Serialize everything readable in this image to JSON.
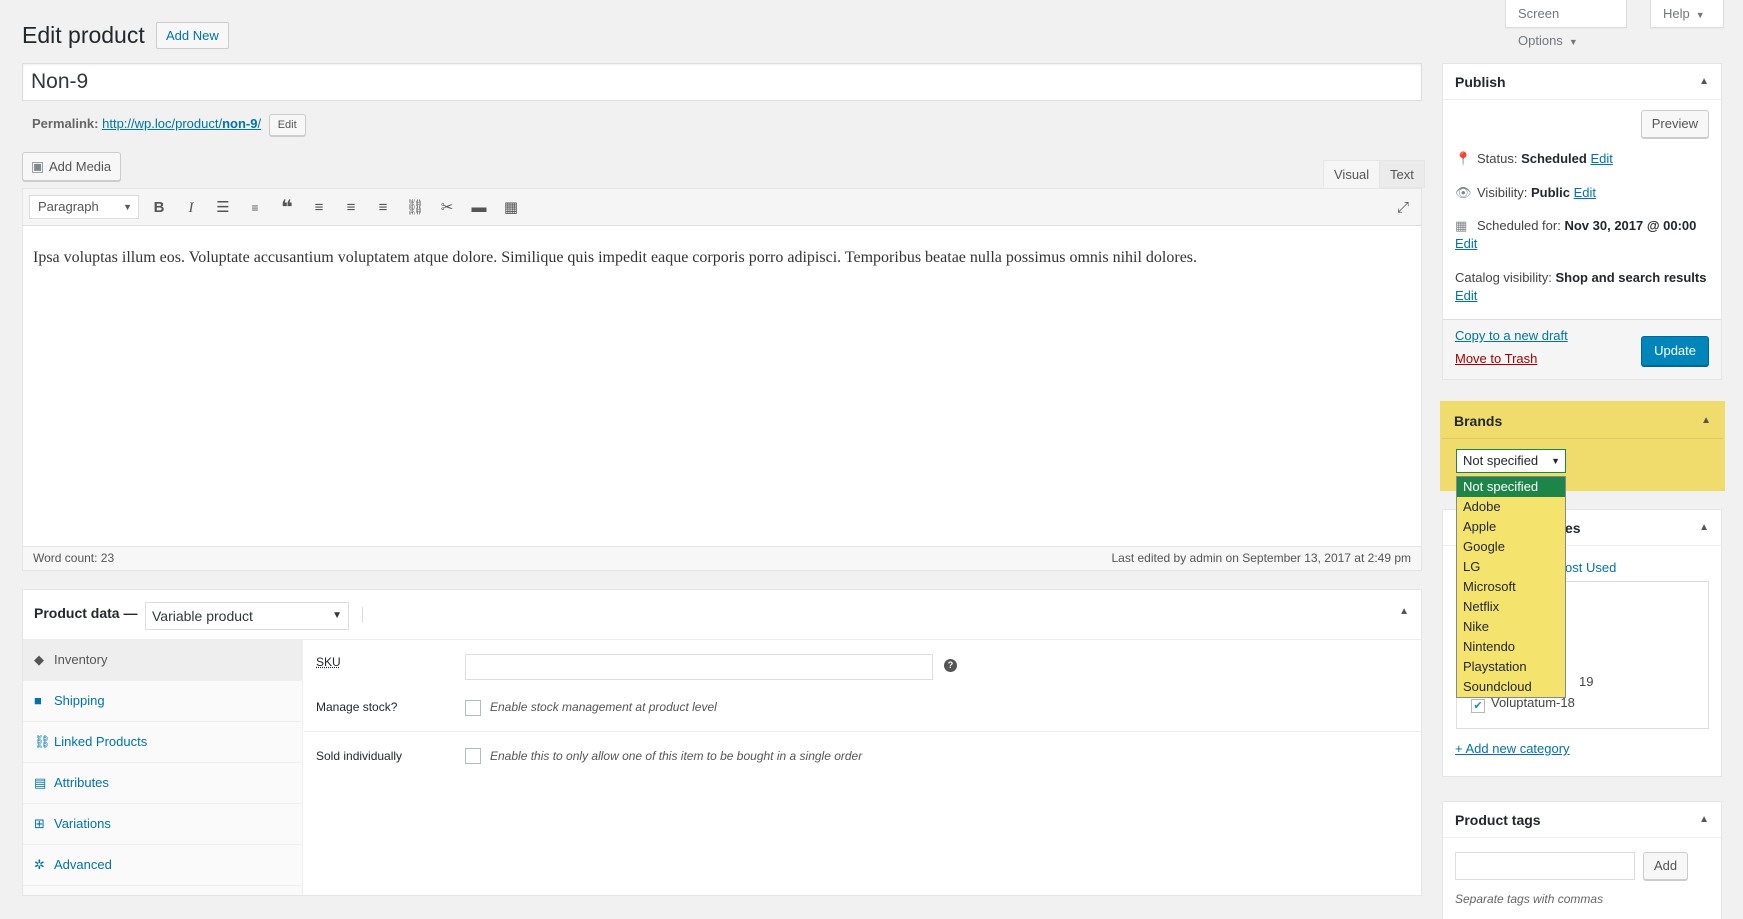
{
  "header": {
    "title": "Edit product",
    "add_new": "Add New",
    "screen_options": "Screen Options",
    "help": "Help"
  },
  "post": {
    "title": "Non-9",
    "permalink_label": "Permalink:",
    "permalink_base": "http://wp.loc/product/",
    "permalink_slug": "non-9",
    "permalink_end": "/",
    "permalink_edit": "Edit"
  },
  "editor": {
    "add_media": "Add Media",
    "tab_visual": "Visual",
    "tab_text": "Text",
    "format": "Paragraph",
    "content": "Ipsa voluptas illum eos. Voluptate accusantium voluptatem atque dolore. Similique quis impedit eaque corporis porro adipisci. Temporibus beatae nulla possimus omnis nihil dolores.",
    "word_count": "Word count: 23",
    "last_edited": "Last edited by admin on September 13, 2017 at 2:49 pm"
  },
  "product_data": {
    "label": "Product data —",
    "type": "Variable product",
    "tabs": [
      "Inventory",
      "Shipping",
      "Linked Products",
      "Attributes",
      "Variations",
      "Advanced"
    ],
    "sku_label": "SKU",
    "manage_stock_label": "Manage stock?",
    "manage_stock_text": "Enable stock management at product level",
    "sold_individually_label": "Sold individually",
    "sold_individually_text": "Enable this to only allow one of this item to be bought in a single order"
  },
  "publish": {
    "title": "Publish",
    "preview": "Preview",
    "status_label": "Status:",
    "status_value": "Scheduled",
    "visibility_label": "Visibility:",
    "visibility_value": "Public",
    "scheduled_label": "Scheduled for:",
    "scheduled_value": "Nov 30, 2017 @ 00:00",
    "catalog_label": "Catalog visibility:",
    "catalog_value": "Shop and search results",
    "edit": "Edit",
    "copy_draft": "Copy to a new draft",
    "trash": "Move to Trash",
    "update": "Update"
  },
  "brands": {
    "title": "Brands",
    "selected": "Not specified",
    "options": [
      "Not specified",
      "Adobe",
      "Apple",
      "Google",
      "LG",
      "Microsoft",
      "Netflix",
      "Nike",
      "Nintendo",
      "Playstation",
      "Soundcloud"
    ],
    "highlight_color": "#f0ce14"
  },
  "categories": {
    "title_partial": "es",
    "most_used_partial": "ost Used",
    "partial_item": "19",
    "checked_item": "Voluptatum-18",
    "add_new": "+ Add new category"
  },
  "tags": {
    "title": "Product tags",
    "add": "Add",
    "help": "Separate tags with commas"
  },
  "colors": {
    "accent": "#0073aa",
    "primary_button": "#0085ba",
    "trash": "#a00",
    "dropdown_selected": "#1e8549"
  }
}
